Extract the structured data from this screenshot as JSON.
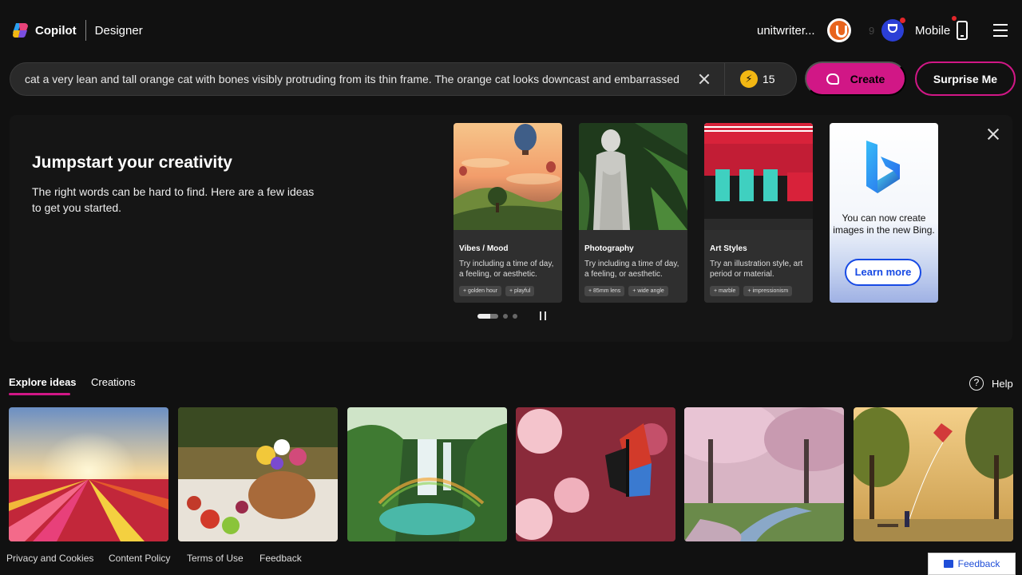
{
  "brand": {
    "name": "Copilot",
    "product": "Designer"
  },
  "user": {
    "name": "unitwriter...",
    "reward_count": "9",
    "mobile_label": "Mobile"
  },
  "prompt": {
    "text": "cat a very lean and tall orange cat with bones visibly protruding from its thin frame. The orange cat looks downcast and embarrassed",
    "boost_count": "15"
  },
  "buttons": {
    "create": "Create",
    "surprise": "Surprise Me"
  },
  "jumpstart": {
    "title": "Jumpstart your creativity",
    "description": "The right words can be hard to find. Here are a few ideas to get you started.",
    "cards": [
      {
        "title": "Vibes / Mood",
        "text": "Try including a time of day, a feeling, or aesthetic.",
        "chips": [
          "+ golden hour",
          "+ playful"
        ]
      },
      {
        "title": "Photography",
        "text": "Try including a time of day, a feeling, or aesthetic.",
        "chips": [
          "+ 85mm lens",
          "+ wide angle"
        ]
      },
      {
        "title": "Art Styles",
        "text": "Try an illustration style, art period or material.",
        "chips": [
          "+ marble",
          "+ impressionism"
        ]
      }
    ],
    "bing_card": {
      "text": "You can now create images in the new Bing.",
      "button": "Learn more"
    }
  },
  "tabs": {
    "explore": "Explore ideas",
    "creations": "Creations",
    "help": "Help"
  },
  "gallery": [
    {
      "icon": "tulip-field-sunset-image"
    },
    {
      "icon": "picnic-basket-image"
    },
    {
      "icon": "waterfall-rainbow-image"
    },
    {
      "icon": "butterfly-blossom-image"
    },
    {
      "icon": "cherry-blossom-park-image"
    },
    {
      "icon": "kite-park-image"
    }
  ],
  "footer": {
    "links": [
      "Privacy and Cookies",
      "Content Policy",
      "Terms of Use",
      "Feedback"
    ],
    "feedback_button": "Feedback"
  },
  "colors": {
    "accent": "#d11786",
    "background": "#111111",
    "bing_blue": "#174ae4"
  }
}
